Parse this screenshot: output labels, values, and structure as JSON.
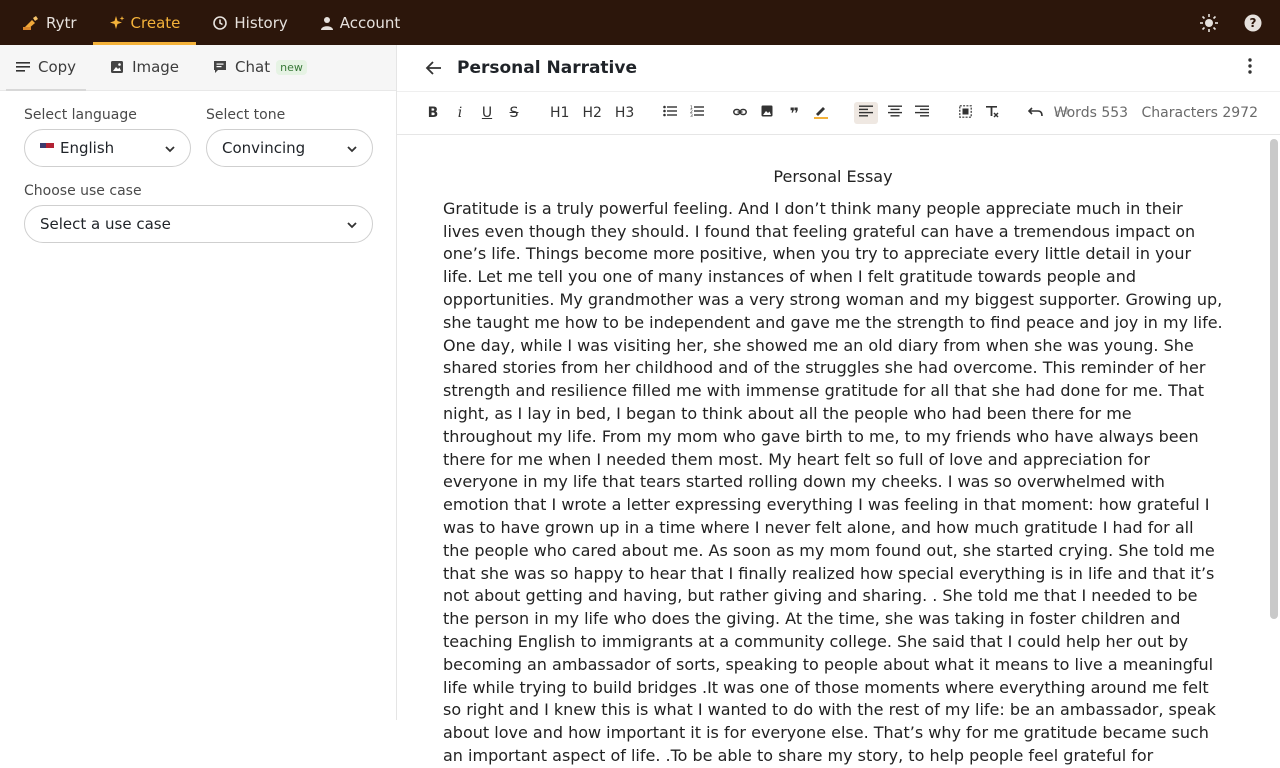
{
  "topnav": {
    "brand": "Rytr",
    "items": [
      {
        "label": "Create",
        "icon": "sparkle-icon"
      },
      {
        "label": "History",
        "icon": "history-icon"
      },
      {
        "label": "Account",
        "icon": "user-icon"
      }
    ],
    "active_color": "#f4b23a",
    "bg_color": "#2c160b"
  },
  "left": {
    "tabs": [
      {
        "label": "Copy",
        "icon": "lines-icon"
      },
      {
        "label": "Image",
        "icon": "image-icon"
      },
      {
        "label": "Chat",
        "icon": "chat-icon",
        "badge": "new"
      }
    ],
    "language_label": "Select language",
    "language_value": "English",
    "tone_label": "Select tone",
    "tone_value": "Convincing",
    "usecase_label": "Choose use case",
    "usecase_placeholder": "Select a use case"
  },
  "editor": {
    "title": "Personal Narrative",
    "toolbar": {
      "h1": "H1",
      "h2": "H2",
      "h3": "H3",
      "words": "Words 553",
      "characters": "Characters 2972"
    },
    "essay_title": "Personal Essay",
    "body": "Gratitude is a truly powerful feeling. And I don’t think many people appreciate much in their lives even though they should. I found that feeling grateful can have a tremendous impact on one’s life. Things become more positive, when you try to appreciate every little detail in your life. Let me tell you one of many instances of when I felt gratitude towards people and opportunities. My grandmother was a very strong woman and my biggest supporter. Growing up, she taught me how to be independent and gave me the strength to find peace and joy in my life. One day, while I was visiting her, she showed me an old diary from when she was young. She shared stories from her childhood and of the struggles she had overcome. This reminder of her strength and resilience filled me with immense gratitude for all that she had done for me. That night, as I lay in bed, I began to think about all the people who had been there for me throughout my life. From my mom who gave birth to me, to my friends who have always been there for me when I needed them most. My heart felt so full of love and appreciation for everyone in my life that tears started rolling down my cheeks. I was so overwhelmed with emotion that I wrote a letter expressing everything I was feeling in that moment: how grateful I was to have grown up in a time where I never felt alone, and how much gratitude I had for all the people who cared about me. As soon as my mom found out, she started crying. She told me that she was so happy to hear that I finally realized how special everything is in life and that it’s not about getting and having, but rather giving and sharing. . She told me that I needed to be the person in my life who does the giving. At the time, she was taking in foster children and teaching English to immigrants at a community college. She said that I could help her out by becoming an ambassador of sorts, speaking to people about what it means to live a meaningful life while trying to build bridges .It was one of those moments where everything around me felt so right and I knew this is what I wanted to do with the rest of my life: be an ambassador, speak about love and how important it is for everyone else. That’s why for me gratitude became such an important aspect of life. .To be able to share my story, to help people feel grateful for"
  }
}
